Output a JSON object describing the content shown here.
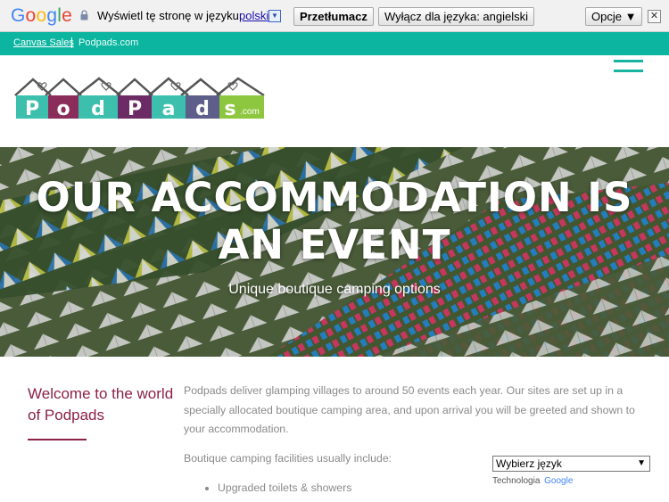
{
  "translate_bar": {
    "logo_letters": [
      "G",
      "o",
      "o",
      "g",
      "l",
      "e"
    ],
    "logo_colors": [
      "#4285f4",
      "#ea4335",
      "#fbbc05",
      "#4285f4",
      "#34a853",
      "#ea4335"
    ],
    "prompt": "Wyświetl tę stronę w języku:",
    "language": "polski",
    "translate_button": "Przetłumacz",
    "disable_button": "Wyłącz dla języka: angielski",
    "options_button": "Opcje ▼",
    "close_label": "✕"
  },
  "top_strip": {
    "link": "Canvas Sales",
    "site": "Podpads.com",
    "color": "#0bb5a0"
  },
  "logo": {
    "letters": [
      "P",
      "o",
      "d",
      "P",
      "a",
      "d",
      "s"
    ],
    "suffix": ".com",
    "colors": [
      "#3dbfae",
      "#8b2d5a",
      "#3dbfae",
      "#6d2b66",
      "#3dbfae",
      "#5e5e8a",
      "#8dc63f"
    ]
  },
  "hero": {
    "title": "OUR ACCOMMODATION IS AN EVENT",
    "subtitle": "Unique boutique camping options"
  },
  "content": {
    "welcome": "Welcome to the world of Podpads",
    "paragraph": "Podpads deliver glamping villages to around 50 events each year. Our sites are set up in a specially allocated boutique camping area, and upon arrival you will be greeted and shown to your accommodation.",
    "facilities_intro": "Boutique camping facilities usually include:",
    "facilities": [
      "Upgraded toilets & showers"
    ]
  },
  "language_widget": {
    "select_value": "Wybierz język",
    "powered_by": "Technologia",
    "google": "Google"
  },
  "accent_color": "#8b2145"
}
